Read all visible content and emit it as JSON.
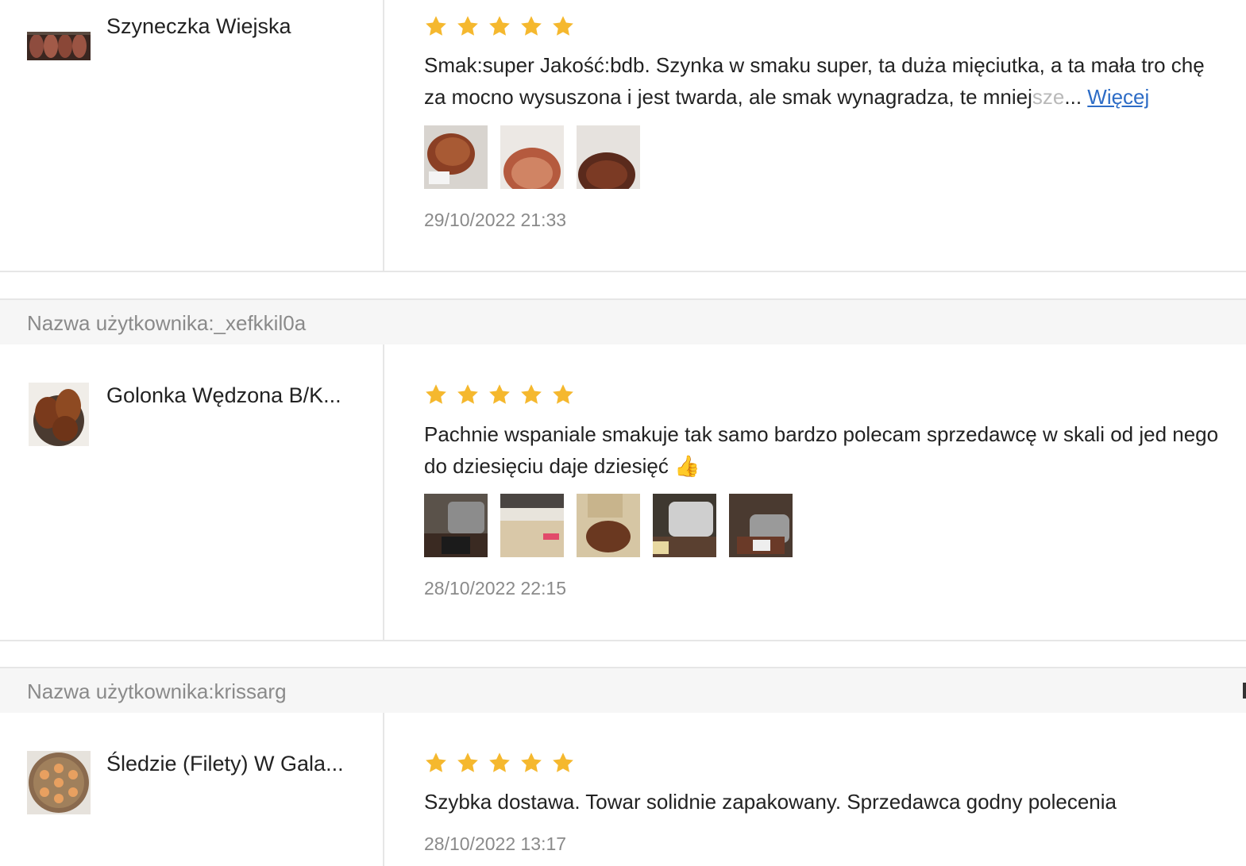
{
  "colors": {
    "star": "#f5b82e",
    "link": "#2d6cc6",
    "muted": "#8a8a8a"
  },
  "reviews": [
    {
      "product_name": "Szyneczka Wiejska",
      "rating": 5,
      "text_main": "Smak:super Jakość:bdb. Szynka w smaku super, ta duża mięciutka, a ta mała tro chę za mocno wysuszona i jest twarda, ale smak wynagradza, te mniej",
      "text_fade": "sze",
      "ellipsis": "...",
      "more_label": "Więcej",
      "photo_count": 3,
      "date": "29/10/2022 21:33"
    },
    {
      "user_label": "Nazwa użytkownika:_xefkkil0a",
      "product_name": "Golonka Wędzona B/K...",
      "rating": 5,
      "text_main": "Pachnie wspaniale smakuje tak samo bardzo polecam sprzedawcę w skali od jed nego do dziesięciu daje dziesięć 👍",
      "photo_count": 5,
      "date": "28/10/2022 22:15"
    },
    {
      "user_label": "Nazwa użytkownika:krissarg",
      "product_name": "Śledzie (Filety) W Gala...",
      "rating": 5,
      "text_main": "Szybka dostawa. Towar solidnie zapakowany. Sprzedawca godny polecenia",
      "date": "28/10/2022 13:17"
    }
  ]
}
